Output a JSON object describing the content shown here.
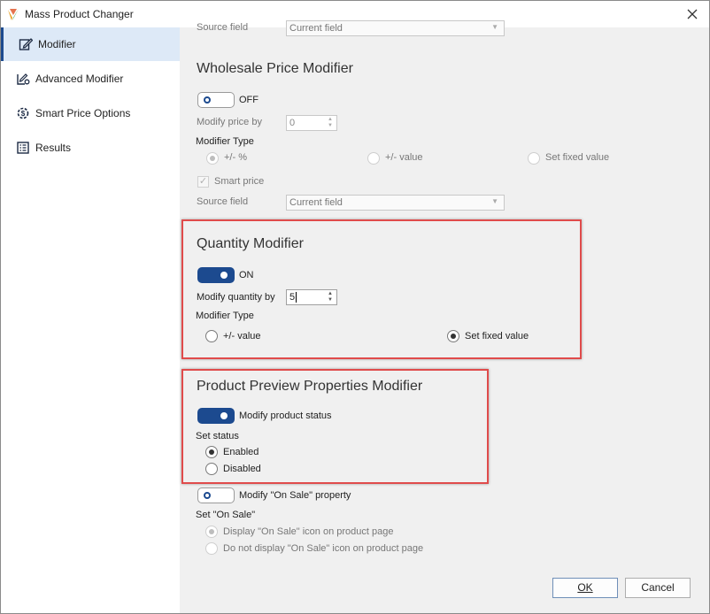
{
  "window": {
    "title": "Mass Product Changer"
  },
  "sidebar": {
    "items": [
      {
        "label": "Modifier",
        "icon": "edit-icon",
        "active": true
      },
      {
        "label": "Advanced Modifier",
        "icon": "advanced-edit-icon",
        "active": false
      },
      {
        "label": "Smart Price Options",
        "icon": "price-gear-icon",
        "active": false
      },
      {
        "label": "Results",
        "icon": "results-list-icon",
        "active": false
      }
    ]
  },
  "top_partial": {
    "source_label": "Source field",
    "source_value": "Current field"
  },
  "wholesale": {
    "title": "Wholesale Price Modifier",
    "toggle_label": "OFF",
    "modify_label": "Modify price by",
    "modify_value": "0",
    "type_label": "Modifier Type",
    "options": [
      "+/- %",
      "+/- value",
      "Set fixed value"
    ],
    "selected": "+/- %",
    "smart_price_label": "Smart price",
    "source_label": "Source field",
    "source_value": "Current field"
  },
  "quantity": {
    "title": "Quantity Modifier",
    "toggle_label": "ON",
    "modify_label": "Modify quantity by",
    "modify_value": "5",
    "type_label": "Modifier Type",
    "options": [
      "+/- value",
      "Set fixed value"
    ],
    "selected": "Set fixed value"
  },
  "preview": {
    "title": "Product Preview Properties Modifier",
    "toggle_label": "Modify product status",
    "status_label": "Set status",
    "options": [
      "Enabled",
      "Disabled"
    ],
    "selected": "Enabled"
  },
  "on_sale": {
    "toggle_label": "Modify \"On Sale\" property",
    "set_label": "Set \"On Sale\"",
    "options": [
      "Display \"On Sale\" icon on product page",
      "Do not display \"On Sale\" icon on product page"
    ],
    "selected": "Display \"On Sale\" icon on product page"
  },
  "buttons": {
    "ok_label": "OK",
    "cancel_label": "Cancel"
  },
  "colors": {
    "accent": "#1c4a8f",
    "highlight": "#e04b4b",
    "content_bg": "#f0f0f0",
    "nav_active_bg": "#dde9f7"
  }
}
